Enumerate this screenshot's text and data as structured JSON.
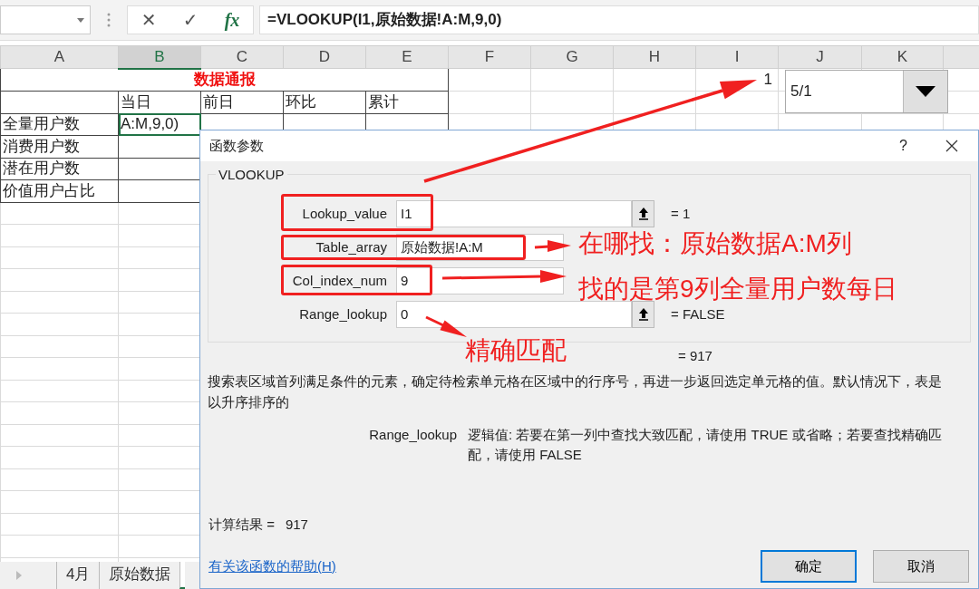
{
  "formula_bar": {
    "cancel": "✕",
    "enter": "✓",
    "function": "fx",
    "formula": "=VLOOKUP(I1,原始数据!A:M,9,0)"
  },
  "columns": [
    {
      "label": "A",
      "selected": false
    },
    {
      "label": "B",
      "selected": true
    },
    {
      "label": "C",
      "selected": false
    },
    {
      "label": "D",
      "selected": false
    },
    {
      "label": "E",
      "selected": false
    },
    {
      "label": "F",
      "selected": false
    },
    {
      "label": "G",
      "selected": false
    },
    {
      "label": "H",
      "selected": false
    },
    {
      "label": "I",
      "selected": false
    },
    {
      "label": "J",
      "selected": false
    },
    {
      "label": "K",
      "selected": false
    }
  ],
  "sheet": {
    "title": "数据通报",
    "headers": [
      "当日",
      "前日",
      "环比",
      "累计"
    ],
    "rows": [
      {
        "label": "全量用户数",
        "value": "A:M,9,0)",
        "selected": true
      },
      {
        "label": "消费用户数",
        "selected": false
      },
      {
        "label": "潜在用户数",
        "selected": false
      },
      {
        "label": "价值用户占比",
        "selected": false
      }
    ],
    "lookup_cell": "1",
    "dropdown": {
      "value": "5/1"
    }
  },
  "sheet_tabs": [
    {
      "label": "4月",
      "selected": false
    },
    {
      "label": "原始数据",
      "selected": false
    }
  ],
  "dialog": {
    "title": "函数参数",
    "help": "?",
    "function_name": "VLOOKUP",
    "arguments": [
      {
        "kind": "full",
        "label": "Lookup_value",
        "value": "I1",
        "result": "=  1"
      },
      {
        "kind": "covered",
        "label": "Table_array",
        "value": "原始数据!A:M"
      },
      {
        "kind": "covered",
        "label": "Col_index_num",
        "value": "9"
      },
      {
        "kind": "full",
        "label": "Range_lookup",
        "value": "0",
        "result": "=  FALSE"
      }
    ],
    "formula_result": "=  917",
    "description": "搜索表区域首列满足条件的元素，确定待检索单元格在区域中的行序号，再进一步返回选定单元格的值。默认情况下，表是以升序排序的",
    "param_name": "Range_lookup",
    "param_help": "逻辑值: 若要在第一列中查找大致匹配，请使用 TRUE 或省略；若要查找精确匹配，请使用 FALSE",
    "calc_label": "计算结果 =",
    "calc_value": "917",
    "help_link": "有关该函数的帮助(H)",
    "buttons": [
      {
        "label": "确定",
        "default": true
      },
      {
        "label": "取消",
        "default": false
      }
    ]
  },
  "annotations": [
    {
      "text": "在哪找：原始数据A:M列"
    },
    {
      "text": "找的是第9列全量用户数每日"
    },
    {
      "text": "精确匹配"
    }
  ]
}
